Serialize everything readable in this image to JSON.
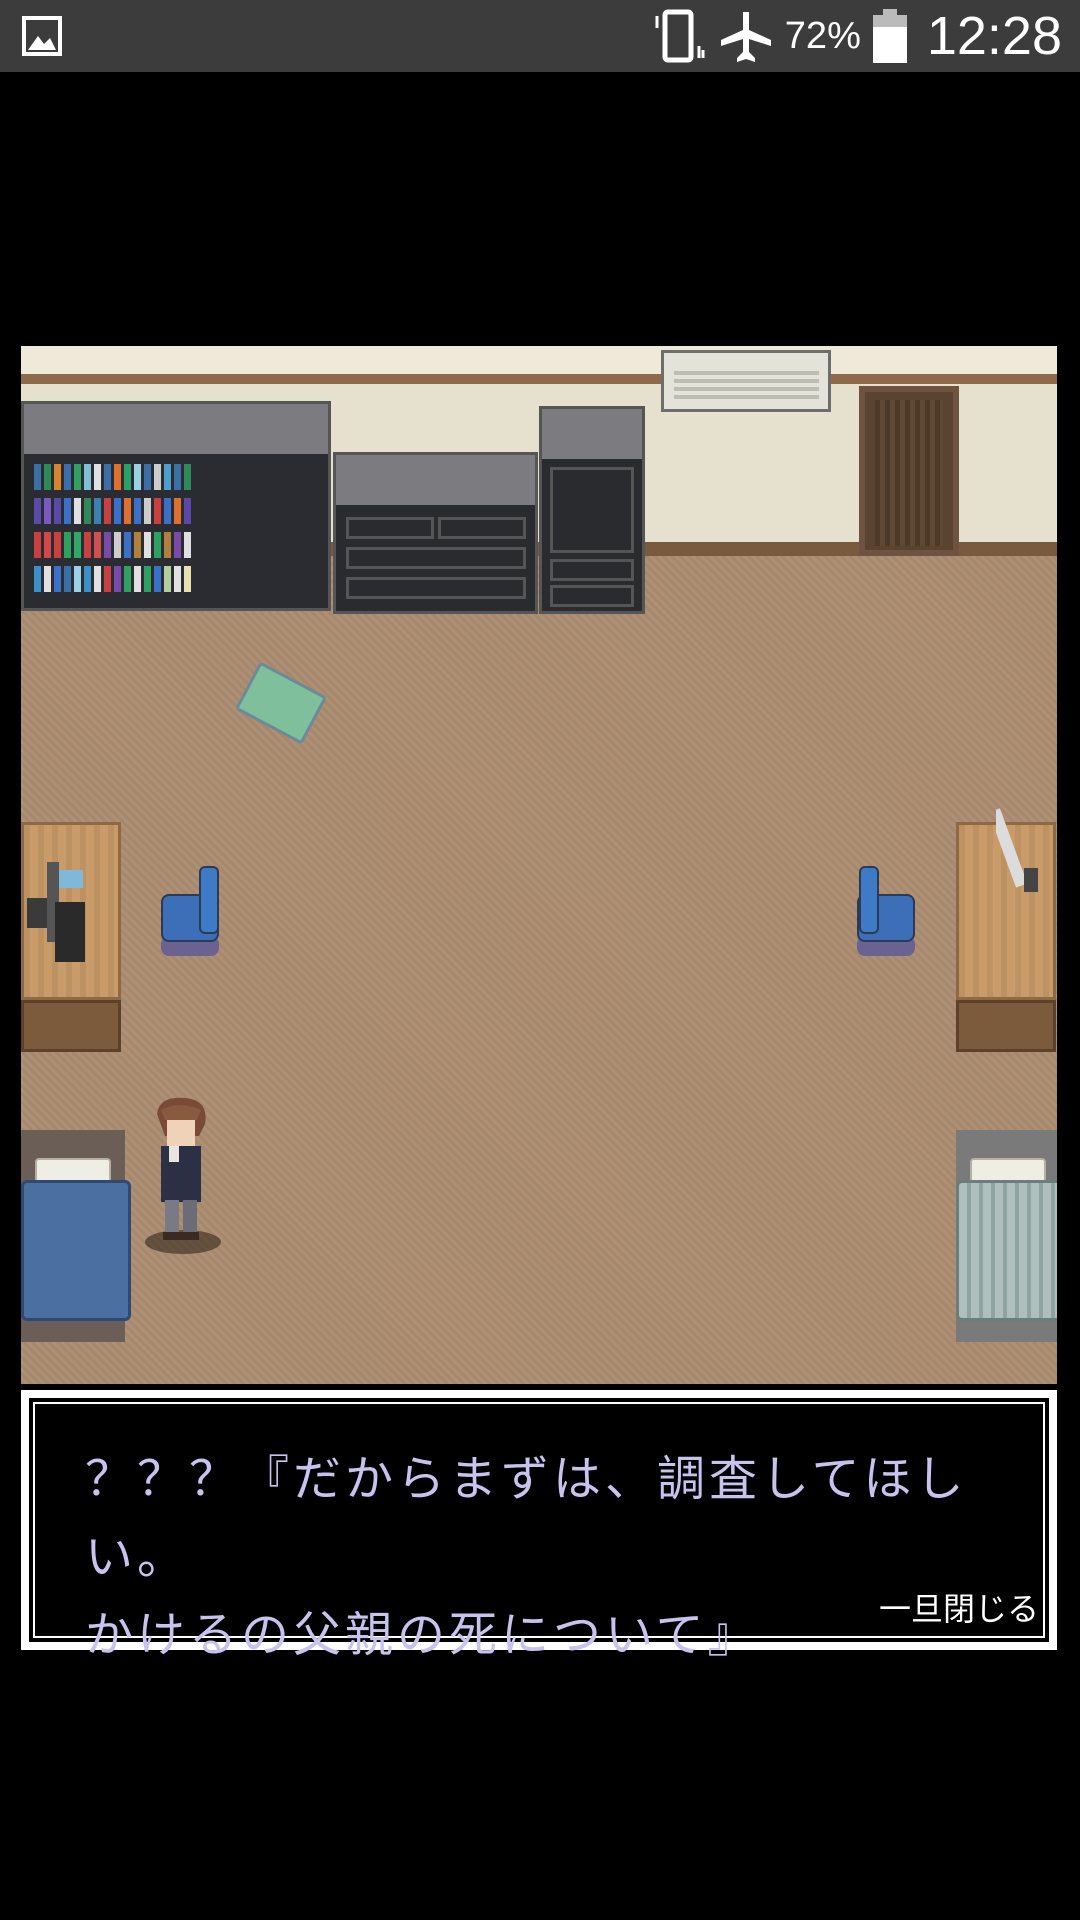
{
  "statusbar": {
    "battery_percent": "72%",
    "time": "12:28",
    "icons": [
      "gallery-icon",
      "vibrate-icon",
      "airplane-mode-icon",
      "battery-icon"
    ]
  },
  "dialog": {
    "line1": "？？？『だからまずは、調査してほしい。",
    "line2": "かけるの父親の死について』",
    "close_label": "一旦閉じる"
  },
  "colors": {
    "carpet": "#ad8e72",
    "wall": "#e6e0cf",
    "dialog_text": "#c7c3ee",
    "chair": "#3f7ac7"
  }
}
